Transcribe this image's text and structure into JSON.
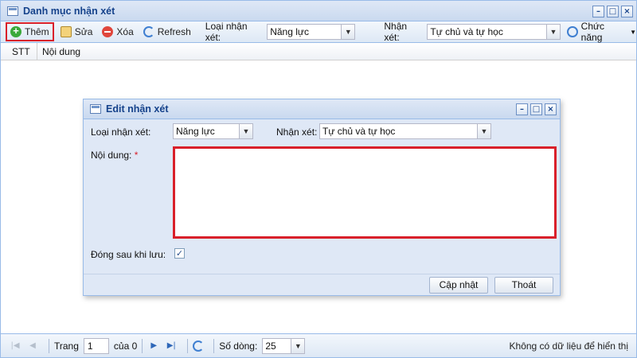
{
  "window": {
    "title": "Danh mục nhận xét"
  },
  "toolbar": {
    "add_label": "Thêm",
    "edit_label": "Sửa",
    "delete_label": "Xóa",
    "refresh_label": "Refresh",
    "type_label": "Loại nhận xét:",
    "type_value": "Năng lực",
    "comment_label": "Nhận xét:",
    "comment_value": "Tự chủ và tự học",
    "functions_label": "Chức năng"
  },
  "grid": {
    "columns": [
      "STT",
      "Nội dung"
    ]
  },
  "paging": {
    "page_label": "Trang",
    "page_value": "1",
    "of_label": "của 0",
    "rows_label": "Số dòng:",
    "rows_value": "25",
    "status": "Không có dữ liệu để hiển thị"
  },
  "dialog": {
    "title": "Edit nhận xét",
    "type_label": "Loại nhận xét:",
    "type_value": "Năng lực",
    "comment_label": "Nhận xét:",
    "comment_value": "Tự chủ và tự học",
    "content_label": "Nội dung:",
    "required_mark": "*",
    "content_value": "",
    "close_after_save_label": "Đóng sau khi lưu:",
    "close_after_save_checked": true,
    "update_button": "Cập nhật",
    "exit_button": "Thoát"
  },
  "icons": {
    "window": "window-icon",
    "add": "add-icon",
    "edit": "edit-icon",
    "delete": "delete-icon",
    "refresh": "refresh-icon",
    "functions": "gear-icon"
  },
  "colors": {
    "highlight": "#d9202a",
    "title_text": "#15428b",
    "panel": "#dfe8f6"
  }
}
